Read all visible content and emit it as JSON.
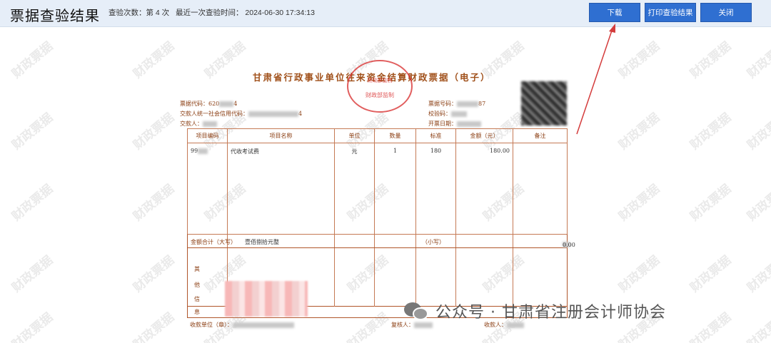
{
  "header": {
    "title": "票据查验结果",
    "check_count": "查验次数：第 4 次",
    "last_check_time": "最近一次查验时间：  2024-06-30 17:34:13",
    "buttons": {
      "download": "下载",
      "print": "打印查验结果",
      "close": "关闭"
    }
  },
  "watermark_text": "财政票据",
  "receipt": {
    "title": "甘肃省行政事业单位往来资金结算财政票据（电子）",
    "seal": {
      "top": "财政部监制",
      "bottom": "财政部监制"
    },
    "code_label": "票据代码：",
    "code_value": "620",
    "code_tail": "4",
    "payer_credit_label": "交款人统一社会信用代码：",
    "payer_credit_tail": "4",
    "payer_label": "交款人：",
    "payer_value": "",
    "number_label": "票据号码：",
    "number_tail": "87",
    "checkcode_label": "校验码：",
    "date_label": "开票日期：",
    "columns": [
      "项目编码",
      "项目名称",
      "单位",
      "数量",
      "标准",
      "金额（元）",
      "备注"
    ],
    "rows": [
      {
        "code": "99",
        "name": "代收考试费",
        "unit": "元",
        "qty": "1",
        "standard": "180",
        "amount": "180.00",
        "remark": ""
      }
    ],
    "total_label": "金额合计（大写）",
    "total_upper": "壹佰捌拾元整",
    "total_small_label": "（小写）",
    "total_small": "0.00",
    "other_info_label": [
      "其",
      "他",
      "信",
      "息"
    ],
    "payee_label": "收款单位（章）：",
    "reviewer_label": "复核人：",
    "collector_label": "收款人："
  },
  "footer_overlay": {
    "text": "公众号 · 甘肃省注册会计师协会"
  },
  "colors": {
    "header_bg": "#e6eef8",
    "button": "#2f6fd1",
    "receipt_ink": "#8a3c10",
    "seal": "#d72828",
    "arrow": "#d43c3c"
  }
}
